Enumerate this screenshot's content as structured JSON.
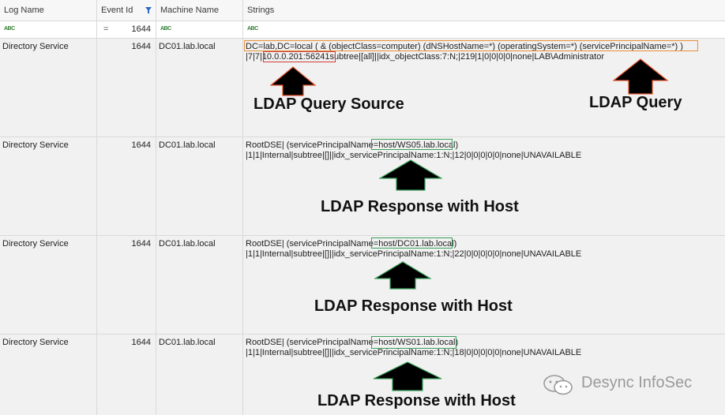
{
  "columns": [
    "Log Name",
    "Event Id",
    "Machine Name",
    "Strings"
  ],
  "filter": {
    "log_name_icon": "ABC",
    "event_id_op": "=",
    "event_id_value": "1644",
    "machine_icon": "ABC",
    "strings_icon": "ABC"
  },
  "rows": [
    {
      "log_name": "Directory Service",
      "event_id": "1644",
      "machine": "DC01.lab.local",
      "line1": "DC=lab,DC=local ( & (objectClass=computer) (dNSHostName=*) (operatingSystem=*) (servicePrincipalName=*) )",
      "line2_pre": "|7|7|",
      "line2_hl": "10.0.0.201:56241",
      "line2_post": "subtree|[all]||idx_objectClass:7:N;|219|1|0|0|0|0|none|LAB\\Administrator",
      "annotation": "LDAP Query Source",
      "annotation2": "LDAP Query"
    },
    {
      "log_name": "Directory Service",
      "event_id": "1644",
      "machine": "DC01.lab.local",
      "line1_pre": "RootDSE| (servicePrincipalName=",
      "line1_hl": "host/WS05.lab.local)",
      "line2": "|1|1|Internal|subtree|[]||idx_servicePrincipalName:1:N;|12|0|0|0|0|0|none|UNAVAILABLE",
      "annotation": "LDAP Response with Host"
    },
    {
      "log_name": "Directory Service",
      "event_id": "1644",
      "machine": "DC01.lab.local",
      "line1_pre": "RootDSE| (servicePrincipalName=",
      "line1_hl": "host/DC01.lab.local)",
      "line2": "|1|1|Internal|subtree|[]||idx_servicePrincipalName:1:N;|22|0|0|0|0|0|none|UNAVAILABLE",
      "annotation": "LDAP Response with Host"
    },
    {
      "log_name": "Directory Service",
      "event_id": "1644",
      "machine": "DC01.lab.local",
      "line1_pre": "RootDSE| (servicePrincipalName=",
      "line1_hl": "host/WS01.lab.local)",
      "line2": "|1|1|Internal|subtree|[]||idx_servicePrincipalName:1:N;|18|0|0|0|0|0|none|UNAVAILABLE",
      "annotation": "LDAP Response with Host"
    }
  ],
  "watermark": "Desync InfoSec",
  "colors": {
    "query_box": "#e8903a",
    "source_box": "#d23c3c",
    "host_box": "#3aa05a",
    "arrow_outline": "#e0502a",
    "arrow_fill": "#000000",
    "filter_icon": "#2a66c8"
  }
}
